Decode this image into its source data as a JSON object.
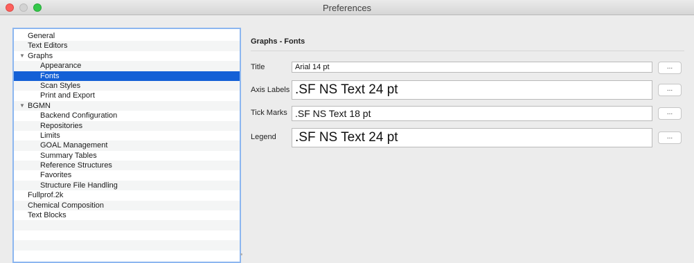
{
  "window": {
    "title": "Preferences"
  },
  "tree": {
    "items": [
      {
        "label": "General",
        "level": 0
      },
      {
        "label": "Text Editors",
        "level": 0
      },
      {
        "label": "Graphs",
        "level": 0,
        "expanded": true
      },
      {
        "label": "Appearance",
        "level": 1
      },
      {
        "label": "Fonts",
        "level": 1,
        "selected": true
      },
      {
        "label": "Scan Styles",
        "level": 1
      },
      {
        "label": "Print and Export",
        "level": 1
      },
      {
        "label": "BGMN",
        "level": 0,
        "expanded": true
      },
      {
        "label": "Backend Configuration",
        "level": 1
      },
      {
        "label": "Repositories",
        "level": 1
      },
      {
        "label": "Limits",
        "level": 1
      },
      {
        "label": "GOAL Management",
        "level": 1
      },
      {
        "label": "Summary Tables",
        "level": 1
      },
      {
        "label": "Reference Structures",
        "level": 1
      },
      {
        "label": "Favorites",
        "level": 1
      },
      {
        "label": "Structure File Handling",
        "level": 1
      },
      {
        "label": "Fullprof.2k",
        "level": 0
      },
      {
        "label": "Chemical Composition",
        "level": 0
      },
      {
        "label": "Text Blocks",
        "level": 0
      }
    ],
    "expand_arrow": "▼"
  },
  "panel": {
    "title": "Graphs - Fonts",
    "fields": [
      {
        "label": "Title",
        "value": "Arial 14 pt"
      },
      {
        "label": "Axis Labels",
        "value": ".SF NS Text 24 pt"
      },
      {
        "label": "Tick Marks",
        "value": ".SF NS Text 18 pt"
      },
      {
        "label": "Legend",
        "value": ".SF NS Text 24 pt"
      }
    ],
    "button_label": "..."
  }
}
